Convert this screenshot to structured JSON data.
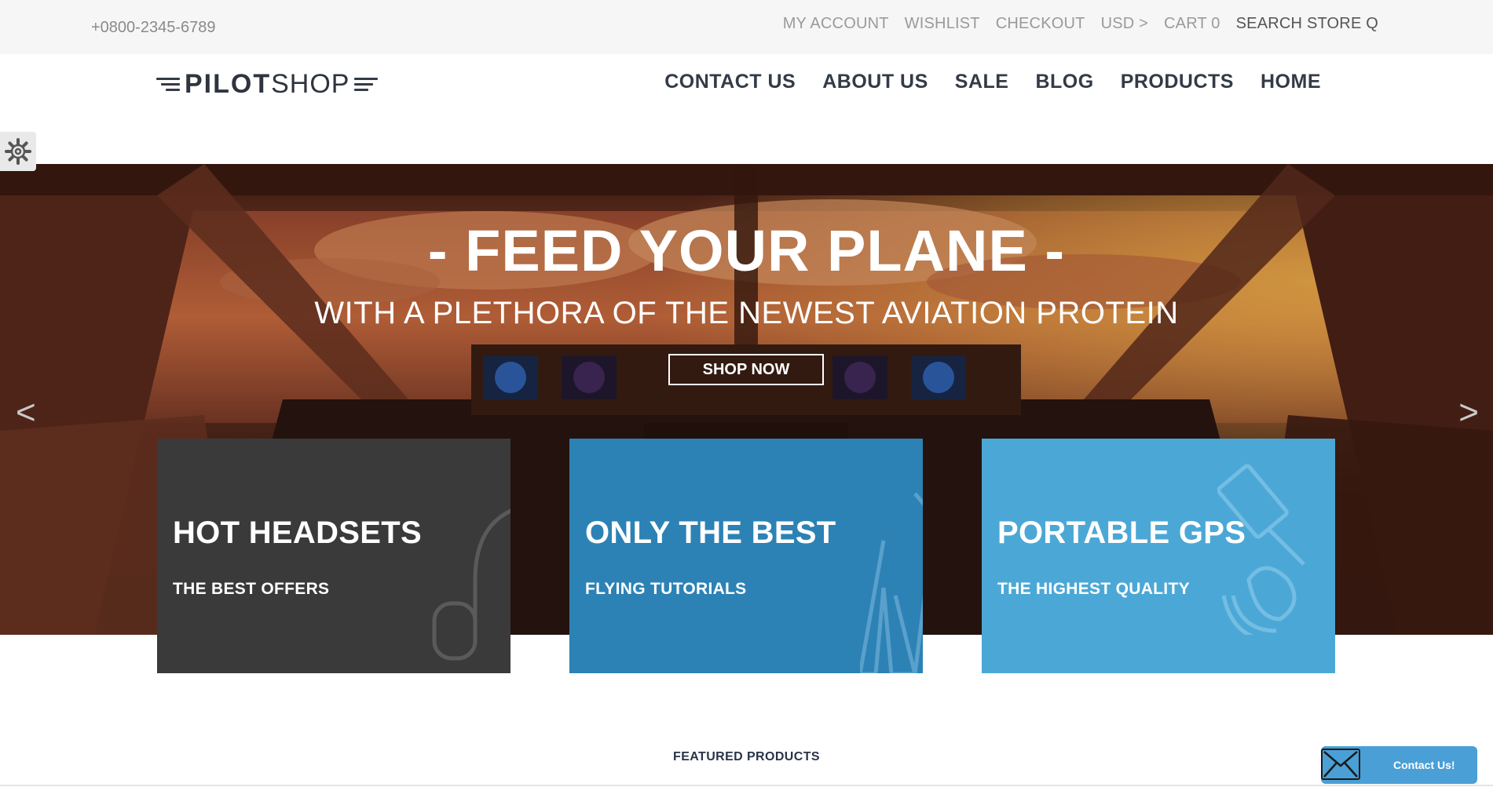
{
  "topbar": {
    "phone": "+0800-2345-6789",
    "links": [
      "MY ACCOUNT",
      "WISHLIST",
      "CHECKOUT",
      "USD >",
      "CART 0",
      "SEARCH STORE Q"
    ]
  },
  "logo": {
    "bold": "PILOT",
    "light": "SHOP"
  },
  "nav": {
    "items": [
      "CONTACT US",
      "ABOUT US",
      "SALE",
      "BLOG",
      "PRODUCTS",
      "HOME"
    ]
  },
  "hero": {
    "title": "- FEED YOUR PLANE -",
    "subtitle": "WITH A PLETHORA OF THE NEWEST AVIATION PROTEIN",
    "button": "SHOP NOW",
    "prev": "<",
    "next": ">"
  },
  "tiles": [
    {
      "title": "HOT HEADSETS",
      "subtitle": "THE BEST OFFERS",
      "icon": "headset-icon",
      "color": "#3a3a3a"
    },
    {
      "title": "ONLY THE BEST",
      "subtitle": "FLYING TUTORIALS",
      "icon": "pilot-jacket-icon",
      "color": "#2c82b5"
    },
    {
      "title": "PORTABLE GPS",
      "subtitle": "THE HIGHEST QUALITY",
      "icon": "satellite-icon",
      "color": "#4ba8d6"
    }
  ],
  "featured": {
    "label": "FEATURED PRODUCTS"
  },
  "contact_widget": {
    "label": "Contact Us!",
    "icon": "envelope-icon"
  },
  "settings": {
    "icon": "gear-icon"
  }
}
